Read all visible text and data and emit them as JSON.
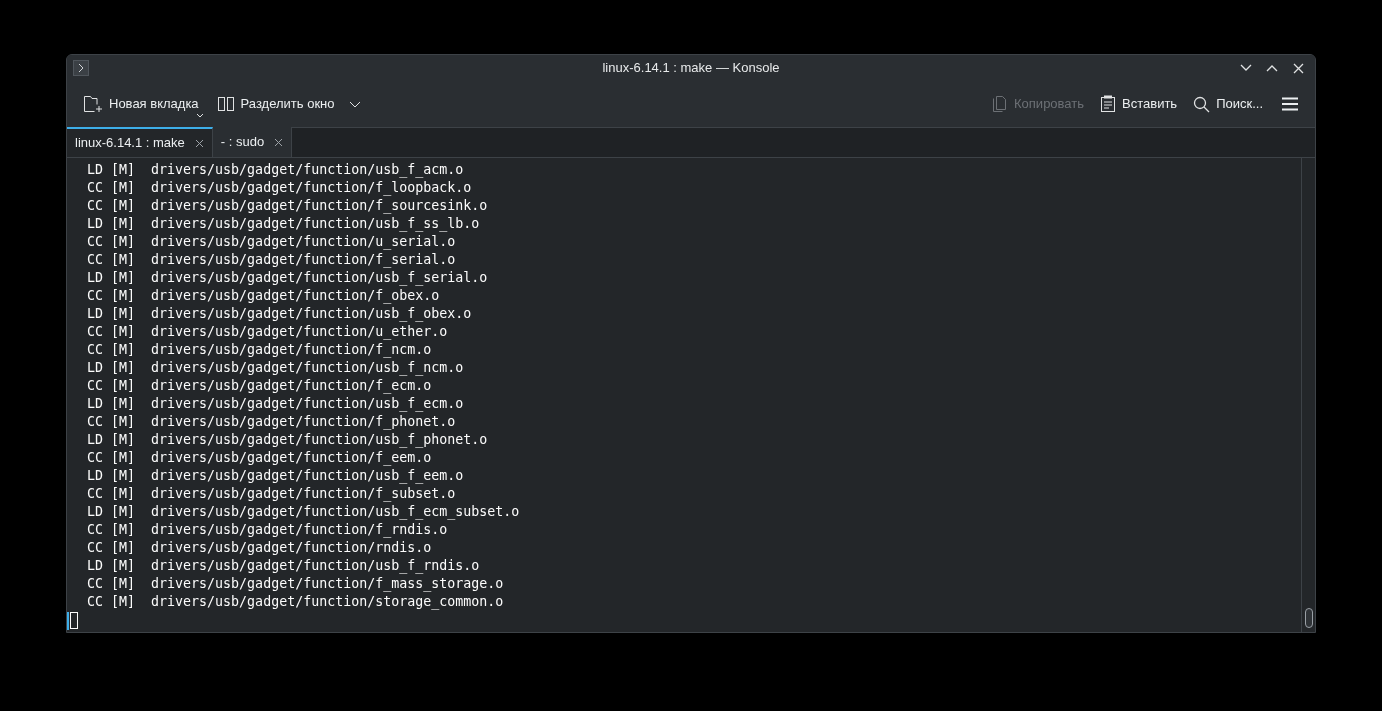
{
  "window": {
    "title": "linux-6.14.1 : make — Konsole"
  },
  "toolbar": {
    "left": [
      {
        "label": "Новая вкладка",
        "kind": "new-tab",
        "disabled": false
      },
      {
        "label": "Разделить окно",
        "kind": "split",
        "disabled": false
      }
    ],
    "right": [
      {
        "label": "Копировать",
        "kind": "copy",
        "disabled": true
      },
      {
        "label": "Вставить",
        "kind": "paste",
        "disabled": false
      },
      {
        "label": "Поиск...",
        "kind": "search",
        "disabled": false
      }
    ]
  },
  "tabs": [
    {
      "label": "linux-6.14.1 : make",
      "selected": true
    },
    {
      "label": "- : sudo",
      "selected": false
    }
  ],
  "terminal": {
    "lines": [
      "  LD [M]  drivers/usb/gadget/function/usb_f_acm.o",
      "  CC [M]  drivers/usb/gadget/function/f_loopback.o",
      "  CC [M]  drivers/usb/gadget/function/f_sourcesink.o",
      "  LD [M]  drivers/usb/gadget/function/usb_f_ss_lb.o",
      "  CC [M]  drivers/usb/gadget/function/u_serial.o",
      "  CC [M]  drivers/usb/gadget/function/f_serial.o",
      "  LD [M]  drivers/usb/gadget/function/usb_f_serial.o",
      "  CC [M]  drivers/usb/gadget/function/f_obex.o",
      "  LD [M]  drivers/usb/gadget/function/usb_f_obex.o",
      "  CC [M]  drivers/usb/gadget/function/u_ether.o",
      "  CC [M]  drivers/usb/gadget/function/f_ncm.o",
      "  LD [M]  drivers/usb/gadget/function/usb_f_ncm.o",
      "  CC [M]  drivers/usb/gadget/function/f_ecm.o",
      "  LD [M]  drivers/usb/gadget/function/usb_f_ecm.o",
      "  CC [M]  drivers/usb/gadget/function/f_phonet.o",
      "  LD [M]  drivers/usb/gadget/function/usb_f_phonet.o",
      "  CC [M]  drivers/usb/gadget/function/f_eem.o",
      "  LD [M]  drivers/usb/gadget/function/usb_f_eem.o",
      "  CC [M]  drivers/usb/gadget/function/f_subset.o",
      "  LD [M]  drivers/usb/gadget/function/usb_f_ecm_subset.o",
      "  CC [M]  drivers/usb/gadget/function/f_rndis.o",
      "  CC [M]  drivers/usb/gadget/function/rndis.o",
      "  LD [M]  drivers/usb/gadget/function/usb_f_rndis.o",
      "  CC [M]  drivers/usb/gadget/function/f_mass_storage.o",
      "  CC [M]  drivers/usb/gadget/function/storage_common.o"
    ]
  }
}
